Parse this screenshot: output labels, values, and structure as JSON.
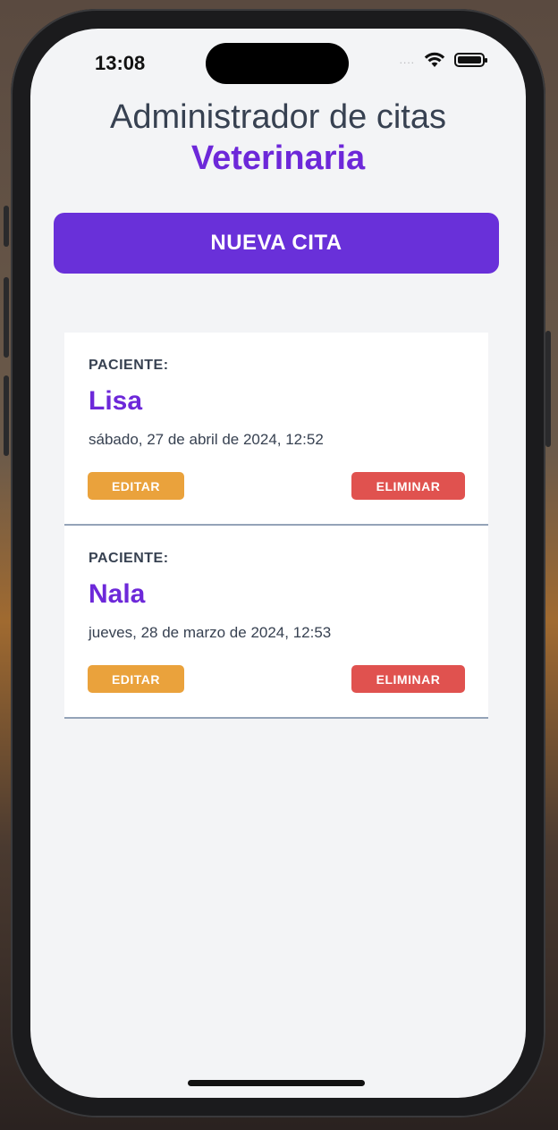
{
  "status_bar": {
    "time": "13:08",
    "signal": "....",
    "icons": [
      "wifi-icon",
      "battery-icon"
    ]
  },
  "header": {
    "title": "Administrador de citas",
    "subtitle": "Veterinaria"
  },
  "actions": {
    "new_label": "NUEVA CITA"
  },
  "appointments": [
    {
      "label": "PACIENTE:",
      "name": "Lisa",
      "date": "sábado, 27 de abril de 2024, 12:52",
      "edit_label": "EDITAR",
      "delete_label": "ELIMINAR"
    },
    {
      "label": "PACIENTE:",
      "name": "Nala",
      "date": "jueves, 28 de marzo de 2024, 12:53",
      "edit_label": "EDITAR",
      "delete_label": "ELIMINAR"
    }
  ],
  "colors": {
    "accent": "#6930d9",
    "edit": "#eaa23c",
    "delete": "#e0524f",
    "background": "#f3f4f6"
  }
}
